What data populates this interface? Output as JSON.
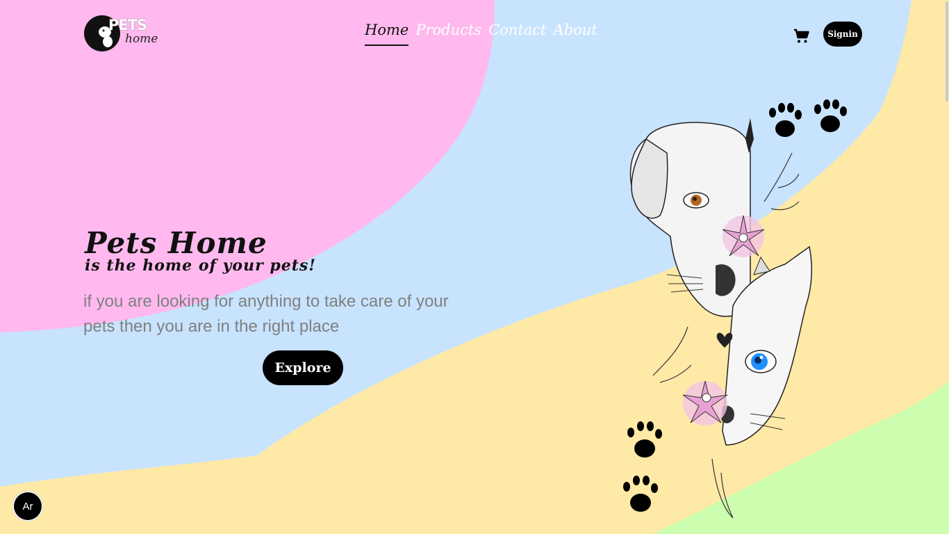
{
  "logo": {
    "title": "PETS",
    "subtitle": "home"
  },
  "nav": {
    "items": [
      {
        "label": "Home",
        "active": true
      },
      {
        "label": "Products",
        "active": false
      },
      {
        "label": "Contact",
        "active": false
      },
      {
        "label": "About",
        "active": false
      }
    ]
  },
  "header": {
    "cart_icon": "shopping-cart-icon",
    "signin_label": "Signin"
  },
  "hero": {
    "title": "Pets Home",
    "subtitle": "is the home of your pets!",
    "description": "if you are looking for anything to take care of your pets then you are in the right place",
    "button_label": "Explore"
  },
  "illustration": {
    "icons": [
      "dog-face-icon",
      "cat-face-icon",
      "flower-icon",
      "paw-print-icon"
    ]
  },
  "language_toggle": {
    "label": "Ar"
  },
  "colors": {
    "pink": "#ffb9ee",
    "blue": "#c8e3fe",
    "yellow": "#ffe9a6",
    "green": "#cdfdae",
    "black": "#000000",
    "text_gray": "#808080"
  }
}
